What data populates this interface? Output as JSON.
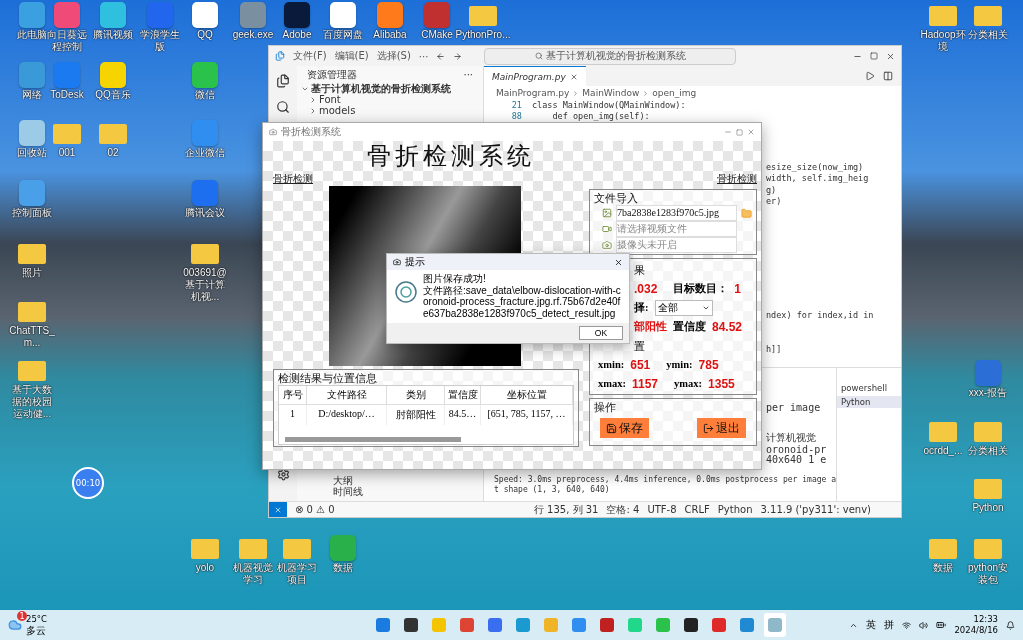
{
  "desktop_icons": [
    {
      "label": "此电脑",
      "kind": "app",
      "color": "#3aa0e0"
    },
    {
      "label": "向日葵远程控制",
      "kind": "app",
      "color": "#f04a78"
    },
    {
      "label": "腾讯视频",
      "kind": "app",
      "color": "#2fc0e0"
    },
    {
      "label": "学浪学生版",
      "kind": "app",
      "color": "#2266ee"
    },
    {
      "label": "QQ",
      "kind": "app",
      "color": "#ffffff"
    },
    {
      "label": "geek.exe",
      "kind": "app",
      "color": "#7a8fa0"
    },
    {
      "label": "Adobe",
      "kind": "app",
      "color": "#0a1a3a"
    },
    {
      "label": "百度网盘",
      "kind": "app",
      "color": "#ffffff"
    },
    {
      "label": "Alibaba",
      "kind": "app",
      "color": "#ff7a1a"
    },
    {
      "label": "CMake",
      "kind": "app",
      "color": "#c03030"
    },
    {
      "label": "PythonPro...",
      "kind": "folder",
      "color": "#f5c842"
    },
    {
      "label": "网络",
      "kind": "app",
      "color": "#3a9ad8"
    },
    {
      "label": "ToDesk",
      "kind": "app",
      "color": "#1c7af0"
    },
    {
      "label": "QQ音乐",
      "kind": "app",
      "color": "#f5d400"
    },
    {
      "label": "微信",
      "kind": "app",
      "color": "#2ac24a"
    },
    {
      "label": "回收站",
      "kind": "app",
      "color": "#9ccbe8"
    },
    {
      "label": "001",
      "kind": "folder",
      "color": "#f5c842"
    },
    {
      "label": "02",
      "kind": "folder",
      "color": "#f5c842"
    },
    {
      "label": "企业微信",
      "kind": "app",
      "color": "#2f8ef0"
    },
    {
      "label": "控制面板",
      "kind": "app",
      "color": "#4aa0e8"
    },
    {
      "label": "腾讯会议",
      "kind": "app",
      "color": "#1e6ff0"
    },
    {
      "label": "照片",
      "kind": "folder",
      "color": "#f5c842"
    },
    {
      "label": "003691@基于计算机视...",
      "kind": "folder",
      "color": "#f5c842"
    },
    {
      "label": "ChatTTS_m...",
      "kind": "folder",
      "color": "#f5c842"
    },
    {
      "label": "基于大数据的校园运动健...",
      "kind": "folder",
      "color": "#f5c842"
    },
    {
      "label": "yolo",
      "kind": "folder",
      "color": "#f5c842"
    },
    {
      "label": "机器视觉学习",
      "kind": "folder",
      "color": "#f5c842"
    },
    {
      "label": "机器学习项目",
      "kind": "folder",
      "color": "#f5c842"
    },
    {
      "label": "数据",
      "kind": "app",
      "color": "#2ab04a"
    },
    {
      "label": "Hadoop环境",
      "kind": "folder",
      "color": "#f5c842"
    },
    {
      "label": "分类相关",
      "kind": "folder",
      "color": "#f5c842"
    },
    {
      "label": "xxx-报告",
      "kind": "app",
      "color": "#2b6fd6"
    },
    {
      "label": "ocrdd_...",
      "kind": "folder",
      "color": "#f5c842"
    },
    {
      "label": "分类相关",
      "kind": "folder",
      "color": "#f5c842"
    },
    {
      "label": "Python",
      "kind": "folder",
      "color": "#f5c842"
    },
    {
      "label": "数据",
      "kind": "folder",
      "color": "#f5c842"
    },
    {
      "label": "python安装包",
      "kind": "folder",
      "color": "#f5c842"
    }
  ],
  "recording_badge": "00:10",
  "vscode": {
    "menu": [
      "文件(F)",
      "编辑(E)",
      "选择(S)",
      "···"
    ],
    "search": "基于计算机视觉的骨折检测系统",
    "explorer": {
      "title": "资源管理器",
      "more": "···",
      "project": "基于计算机视觉的骨折检测系统",
      "folders": [
        "Font",
        "models"
      ],
      "bottom": [
        "大纲",
        "时间线"
      ]
    },
    "tab": {
      "label": "MainProgram.py",
      "selected": true
    },
    "breadcrumb": [
      "MainProgram.py",
      "MainWindow",
      "open_img"
    ],
    "code_lines": [
      {
        "number": "21",
        "text": "class MainWindow(QMainWindow):"
      },
      {
        "number": "88",
        "text": "    def open_img(self):"
      }
    ],
    "code_fragments": [
      "esize_size(now_img)",
      "width, self.img_heig",
      "g)",
      "er)",
      "ndex) for index,id in",
      "h]]"
    ],
    "terminal_fragments": [
      "per image",
      "计算机视觉",
      "oronoid-pr",
      "40x640 1 e"
    ],
    "terminal_lines": [
      "Speed: 3.0ms preprocess, 4.4ms inference, 0.0ms postprocess per image a",
      "t shape (1, 3, 640, 640)"
    ],
    "terminals": [
      {
        "label": "powershell",
        "selected": false
      },
      {
        "label": "Python",
        "selected": true
      }
    ],
    "status_left": [
      "⊗ 0 ⚠ 0"
    ],
    "status_right": [
      "行 135, 列 31",
      "空格: 4",
      "UTF-8",
      "CRLF",
      "Python",
      "3.11.9 ('py311': venv)"
    ]
  },
  "app": {
    "title": "骨折检测系统",
    "heading": "骨折检测系统",
    "left_label": "骨折检测",
    "right_label": "骨折检测",
    "file_import": {
      "title": "文件导入",
      "rows": [
        {
          "kind": "image",
          "value": "7ba2838e1283f970c5.jpg"
        },
        {
          "kind": "video",
          "placeholder": "请选择视频文件"
        },
        {
          "kind": "camera",
          "placeholder": "摄像头未开启"
        }
      ]
    },
    "result": {
      "title": "果",
      "time": ".032",
      "count_label": "目标数目：",
      "count": "1",
      "select_label": "择:",
      "select_value": "全部",
      "class": "部阳性",
      "conf_label": "置信度",
      "conf": "84.52",
      "pos_title": "置",
      "coords": [
        {
          "label": "xmin:",
          "value": "651"
        },
        {
          "label": "ymin:",
          "value": "785"
        },
        {
          "label": "xmax:",
          "value": "1157"
        },
        {
          "label": "ymax:",
          "value": "1355"
        }
      ]
    },
    "operation": {
      "title": "操作",
      "buttons": [
        "保存",
        "退出"
      ]
    },
    "table": {
      "title": "检测结果与位置信息",
      "columns": [
        "序号",
        "文件路径",
        "类别",
        "置信度",
        "坐标位置"
      ],
      "rows": [
        [
          "1",
          "D:/desktop/…",
          "肘部阳性",
          "84.5…",
          "[651, 785, 1157, …"
        ]
      ]
    }
  },
  "dialog": {
    "title": "提示",
    "message": "图片保存成功!",
    "path": "文件路径:save_data\\elbow-dislocation-with-coronoid-process_fracture.jpg.rf.75b67d2e40fe637ba2838e1283f970c5_detect_result.jpg",
    "button": "OK"
  },
  "taskbar": {
    "weather": {
      "temp": "25°C",
      "desc": "多云",
      "badge": "1"
    },
    "apps": [
      {
        "kind": "start",
        "active": false
      },
      {
        "kind": "taskview",
        "active": false
      },
      {
        "kind": "norton",
        "active": false
      },
      {
        "kind": "chrome",
        "active": false
      },
      {
        "kind": "signal",
        "active": false
      },
      {
        "kind": "edge",
        "active": false
      },
      {
        "kind": "files",
        "active": false
      },
      {
        "kind": "chat",
        "active": false
      },
      {
        "kind": "battery",
        "active": false
      },
      {
        "kind": "pycharm",
        "active": false
      },
      {
        "kind": "wechat",
        "active": false
      },
      {
        "kind": "qq",
        "active": false
      },
      {
        "kind": "wps",
        "active": false
      },
      {
        "kind": "vscode",
        "active": false
      },
      {
        "kind": "app",
        "active": true
      }
    ],
    "ime": [
      "英",
      "拼"
    ],
    "time": "12:33",
    "date": "2024/8/16"
  }
}
